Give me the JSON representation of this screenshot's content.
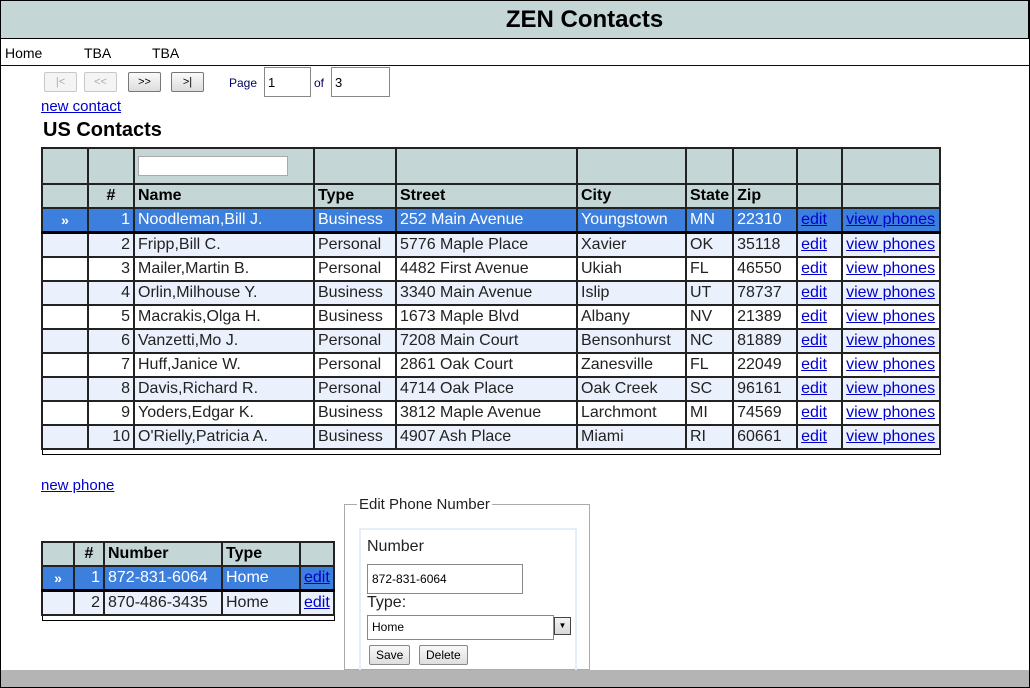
{
  "app": {
    "title": "ZEN Contacts"
  },
  "menu": {
    "items": [
      {
        "label": "Home"
      },
      {
        "label": "TBA"
      },
      {
        "label": "TBA"
      }
    ]
  },
  "pager": {
    "first_label": "|<",
    "prev_label": "<<",
    "next_label": ">>",
    "last_label": ">|",
    "page_label": "Page",
    "of_label": "of",
    "current_page": "1",
    "total_pages": "3"
  },
  "links": {
    "new_contact": "new contact",
    "new_phone": "new phone"
  },
  "contacts": {
    "title": "US Contacts",
    "filter_value": "",
    "columns": [
      "",
      "#",
      "Name",
      "Type",
      "Street",
      "City",
      "State",
      "Zip",
      "",
      ""
    ],
    "edit_label": "edit",
    "view_label": "view phones",
    "selected_marker": "»",
    "rows": [
      {
        "id": "1",
        "name": "Noodleman,Bill J.",
        "type": "Business",
        "street": "252 Main Avenue",
        "city": "Youngstown",
        "state": "MN",
        "zip": "22310",
        "selected": true
      },
      {
        "id": "2",
        "name": "Fripp,Bill C.",
        "type": "Personal",
        "street": "5776 Maple Place",
        "city": "Xavier",
        "state": "OK",
        "zip": "35118"
      },
      {
        "id": "3",
        "name": "Mailer,Martin B.",
        "type": "Personal",
        "street": "4482 First Avenue",
        "city": "Ukiah",
        "state": "FL",
        "zip": "46550"
      },
      {
        "id": "4",
        "name": "Orlin,Milhouse Y.",
        "type": "Business",
        "street": "3340 Main Avenue",
        "city": "Islip",
        "state": "UT",
        "zip": "78737"
      },
      {
        "id": "5",
        "name": "Macrakis,Olga H.",
        "type": "Business",
        "street": "1673 Maple Blvd",
        "city": "Albany",
        "state": "NV",
        "zip": "21389"
      },
      {
        "id": "6",
        "name": "Vanzetti,Mo J.",
        "type": "Personal",
        "street": "7208 Main Court",
        "city": "Bensonhurst",
        "state": "NC",
        "zip": "81889"
      },
      {
        "id": "7",
        "name": "Huff,Janice W.",
        "type": "Personal",
        "street": "2861 Oak Court",
        "city": "Zanesville",
        "state": "FL",
        "zip": "22049"
      },
      {
        "id": "8",
        "name": "Davis,Richard R.",
        "type": "Personal",
        "street": "4714 Oak Place",
        "city": "Oak Creek",
        "state": "SC",
        "zip": "96161"
      },
      {
        "id": "9",
        "name": "Yoders,Edgar K.",
        "type": "Business",
        "street": "3812 Maple Avenue",
        "city": "Larchmont",
        "state": "MI",
        "zip": "74569"
      },
      {
        "id": "10",
        "name": "O'Rielly,Patricia A.",
        "type": "Business",
        "street": "4907 Ash Place",
        "city": "Miami",
        "state": "RI",
        "zip": "60661"
      }
    ]
  },
  "phones": {
    "columns": [
      "",
      "#",
      "Number",
      "Type",
      ""
    ],
    "edit_label": "edit",
    "selected_marker": "»",
    "rows": [
      {
        "id": "1",
        "number": "872-831-6064",
        "type": "Home",
        "selected": true
      },
      {
        "id": "2",
        "number": "870-486-3435",
        "type": "Home"
      }
    ]
  },
  "edit_phone": {
    "legend": "Edit Phone Number",
    "number_label": "Number",
    "number_value": "872-831-6064",
    "type_label": "Type:",
    "type_value": "Home",
    "save_label": "Save",
    "delete_label": "Delete"
  },
  "colors": {
    "header_bg": "#c5d6d6",
    "selected_row": "#3d7fdc",
    "alt_row": "#eaf1fc",
    "link": "#0000cc"
  }
}
